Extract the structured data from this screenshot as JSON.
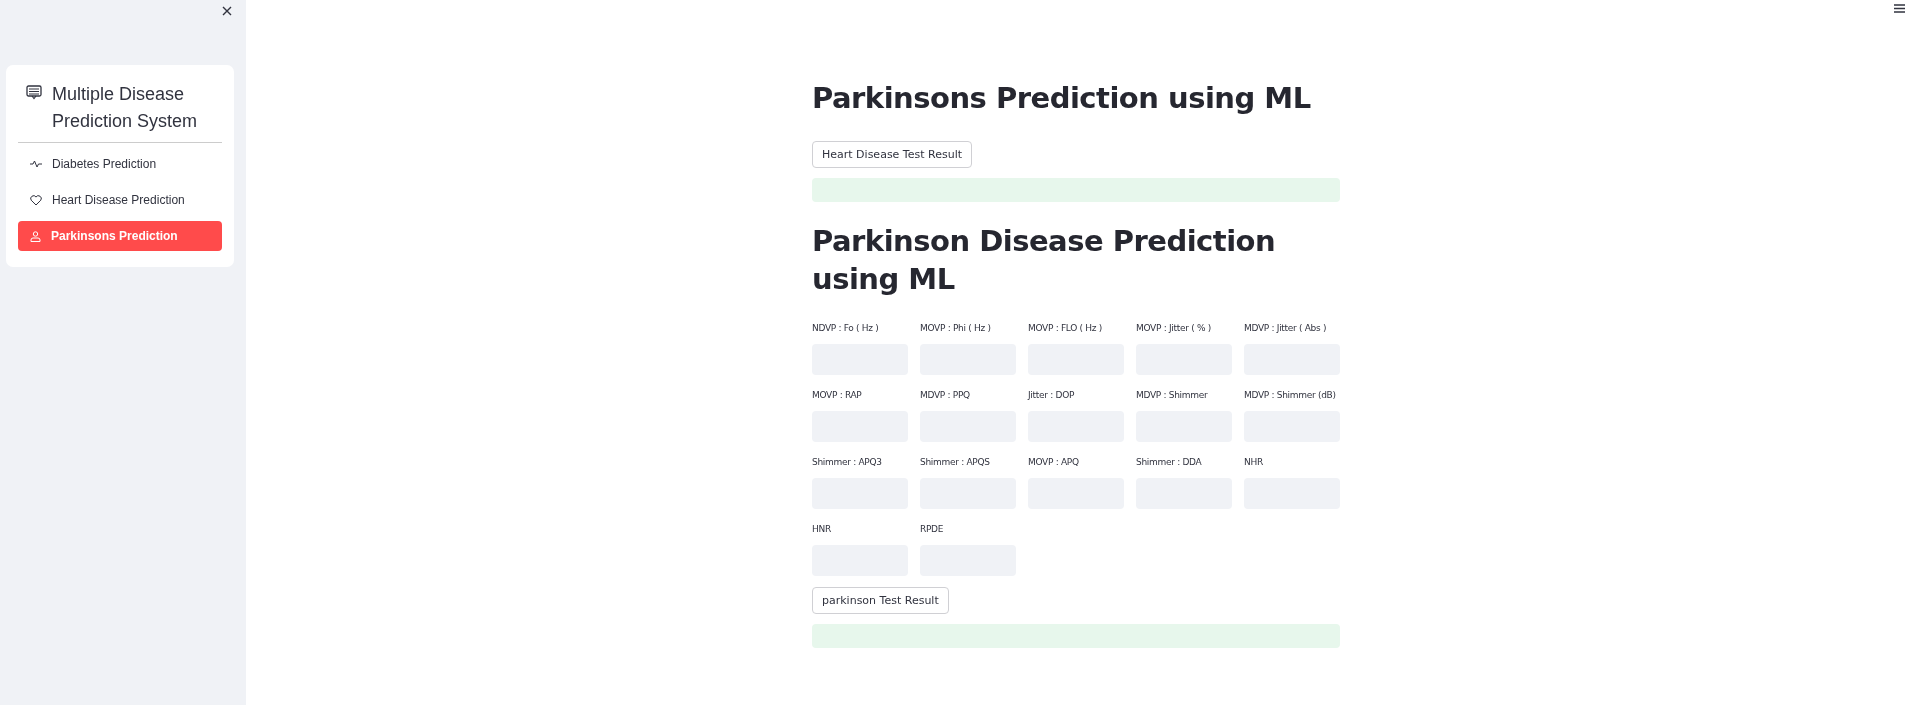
{
  "sidebar": {
    "title": "Multiple Disease Prediction System",
    "items": [
      {
        "label": "Diabetes Prediction",
        "kind": "activity",
        "selected": false
      },
      {
        "label": "Heart Disease Prediction",
        "kind": "heart",
        "selected": false
      },
      {
        "label": "Parkinsons Prediction",
        "kind": "person",
        "selected": true
      }
    ]
  },
  "main": {
    "title": "Parkinsons Prediction using ML",
    "heart_button": "Heart Disease Test Result",
    "heading": "Parkinson Disease Prediction using ML",
    "fields": [
      {
        "label": "NDVP : Fo ( Hz )"
      },
      {
        "label": "MOVP : Phi ( Hz )"
      },
      {
        "label": "MOVP : FLO ( Hz )"
      },
      {
        "label": "MOVP : Jitter ( % )"
      },
      {
        "label": "MDVP : Jitter ( Abs )"
      },
      {
        "label": "MOVP : RAP"
      },
      {
        "label": "MDVP : PPQ"
      },
      {
        "label": "Jitter : DOP"
      },
      {
        "label": "MDVP : Shimmer"
      },
      {
        "label": "MDVP : Shimmer (dB)"
      },
      {
        "label": "Shimmer : APQ3"
      },
      {
        "label": "Shimmer : APQS"
      },
      {
        "label": "MOVP : APQ"
      },
      {
        "label": "Shimmer : DDA"
      },
      {
        "label": "NHR"
      },
      {
        "label": "HNR"
      },
      {
        "label": "RPDE"
      }
    ],
    "parkinson_button": "parkinson Test Result"
  }
}
